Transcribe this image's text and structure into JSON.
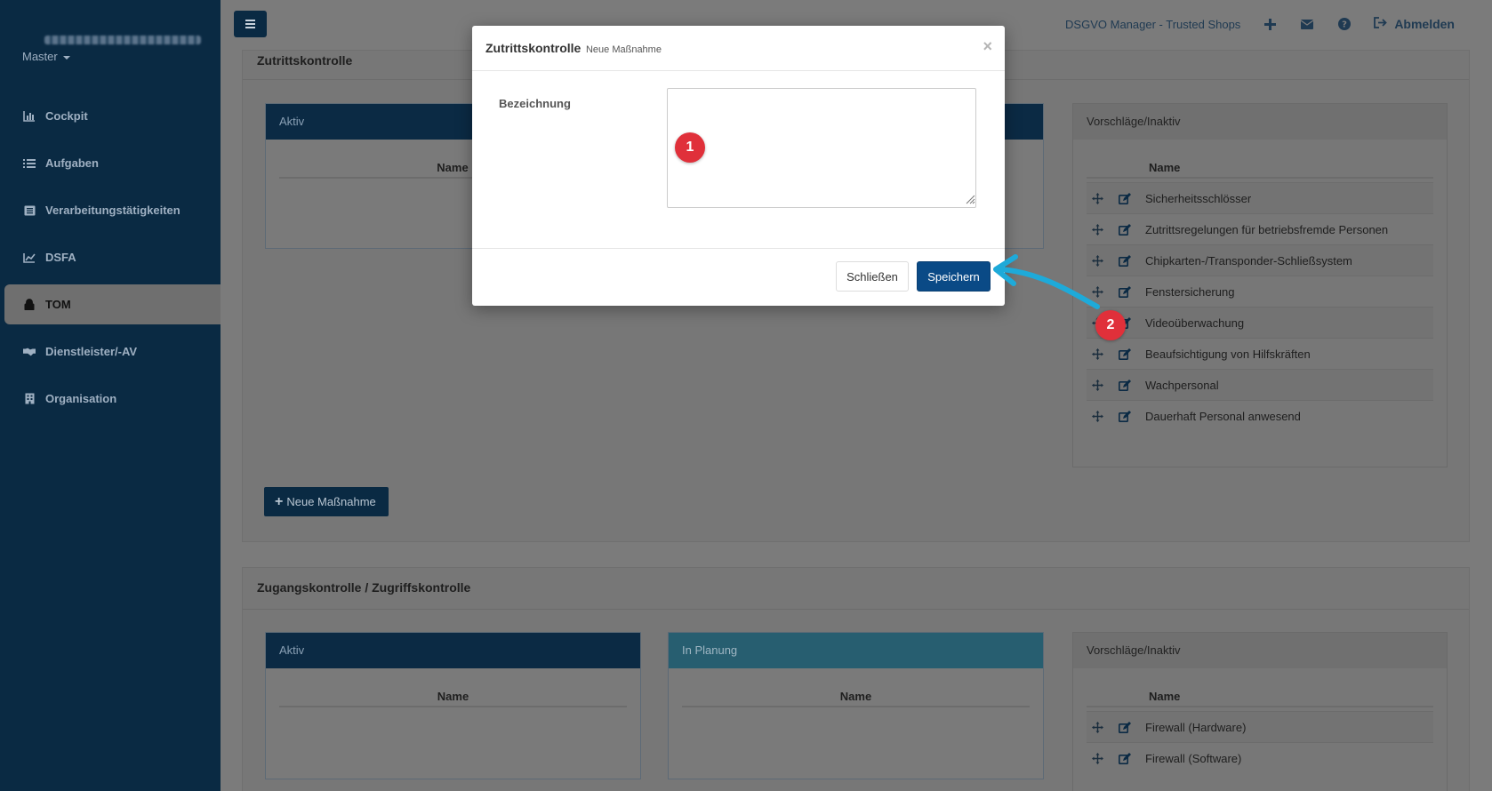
{
  "sidebar": {
    "tenant": "Master",
    "items": [
      {
        "label": "Cockpit",
        "icon": "bar-chart-icon"
      },
      {
        "label": "Aufgaben",
        "icon": "tasks-icon"
      },
      {
        "label": "Verarbeitungstätigkeiten",
        "icon": "list-alt-icon"
      },
      {
        "label": "DSFA",
        "icon": "area-chart-icon"
      },
      {
        "label": "TOM",
        "icon": "lock-icon",
        "active": true
      },
      {
        "label": "Dienstleister/-AV",
        "icon": "handshake-icon"
      },
      {
        "label": "Organisation",
        "icon": "building-icon"
      }
    ]
  },
  "topbar": {
    "app_name": "DSGVO Manager - Trusted Shops",
    "logout": "Abmelden"
  },
  "section1": {
    "title": "Zutrittskontrolle",
    "active_panel": {
      "title": "Aktiv",
      "col": "Name"
    },
    "suggestions_panel": {
      "title": "Vorschläge/Inaktiv",
      "col": "Name",
      "rows": [
        "Sicherheitsschlösser",
        "Zutrittsregelungen für betriebsfremde Personen",
        "Chipkarten-/Transponder-Schließsystem",
        "Fenstersicherung",
        "Videoüberwachung",
        "Beaufsichtigung von Hilfskräften",
        "Wachpersonal",
        "Dauerhaft Personal anwesend"
      ]
    },
    "new_button": "Neue Maßnahme"
  },
  "section2": {
    "title": "Zugangskontrolle / Zugriffskontrolle",
    "active_panel": {
      "title": "Aktiv",
      "col": "Name"
    },
    "planning_panel": {
      "title": "In Planung",
      "col": "Name"
    },
    "suggestions_panel": {
      "title": "Vorschläge/Inaktiv",
      "col": "Name",
      "rows": [
        "Firewall (Hardware)",
        "Firewall (Software)"
      ]
    }
  },
  "modal": {
    "title": "Zutrittskontrolle",
    "subtitle": "Neue Maßnahme",
    "close_symbol": "×",
    "field_label": "Bezeichnung",
    "field_value": "",
    "close_button": "Schließen",
    "save_button": "Speichern"
  },
  "annotations": {
    "marker1": "1",
    "marker2": "2",
    "arrow_color": "#1eaad9",
    "marker_color": "#e0303a"
  }
}
